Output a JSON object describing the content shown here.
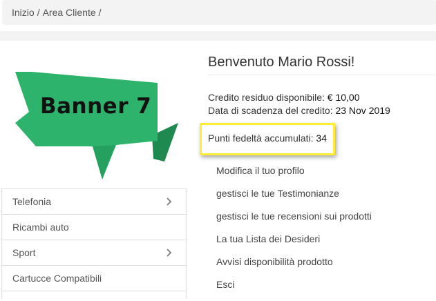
{
  "breadcrumb": {
    "home": "Inizio",
    "sep": "/",
    "current": "Area Cliente",
    "sep2": "/"
  },
  "banner": {
    "text": "Banner 7",
    "color": "#2db36b"
  },
  "menu": [
    {
      "label": "Telefonia",
      "has_chevron": true
    },
    {
      "label": "Ricambi auto",
      "has_chevron": false
    },
    {
      "label": "Sport",
      "has_chevron": true
    },
    {
      "label": "Cartucce Compatibili",
      "has_chevron": false
    }
  ],
  "account": {
    "welcome": "Benvenuto Mario Rossi!",
    "credit_label": "Credito residuo disponibile:",
    "credit_value": "€ 10,00",
    "expiry_label": "Data di scadenza del credito:",
    "expiry_value": "23 Nov 2019",
    "points_label": "Punti fedeltà accumulati:",
    "points_value": "34",
    "highlight_color": "#ffee33"
  },
  "links": [
    "Modifica il tuo profilo",
    "gestisci le tue Testimonianze",
    "gestisci le tue recensioni sui prodotti",
    "La tua Lista dei Desideri",
    "Avvisi disponibilità prodotto",
    "Esci"
  ]
}
